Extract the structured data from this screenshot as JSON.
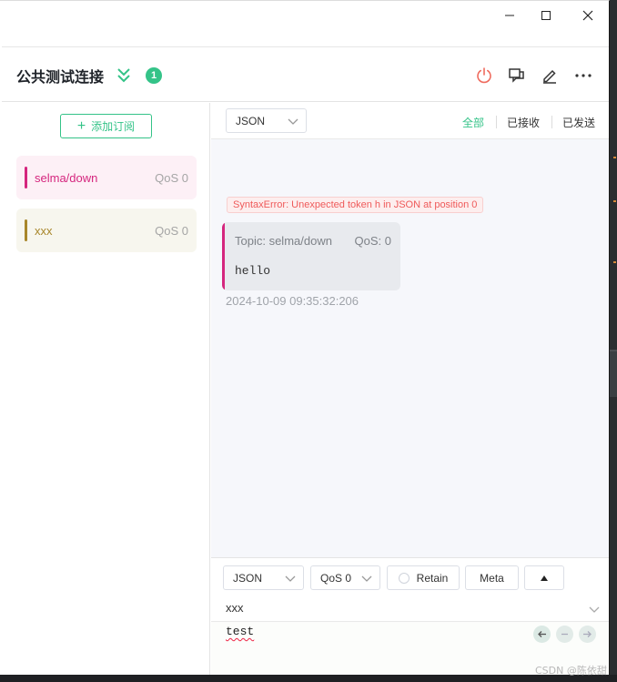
{
  "window": {
    "controls": [
      "minimize",
      "maximize",
      "close"
    ]
  },
  "header": {
    "title": "公共测试连接",
    "badge_count": "1",
    "icons": [
      "disconnect-icon",
      "new-window-icon",
      "edit-icon",
      "more-icon"
    ]
  },
  "sidebar": {
    "add_subscription_label": "添加订阅",
    "subscriptions": [
      {
        "topic": "selma/down",
        "qos": "QoS 0",
        "color": "#d5267e",
        "bg": "#fdf0f6"
      },
      {
        "topic": "xxx",
        "qos": "QoS 0",
        "color": "#a8862a",
        "bg": "#f7f6ee"
      }
    ]
  },
  "messages_toolbar": {
    "format": "JSON",
    "filters": [
      "全部",
      "已接收",
      "已发送"
    ],
    "active_filter": "全部"
  },
  "error_banner": "SyntaxError: Unexpected token h in JSON at position 0",
  "messages": [
    {
      "topic_label": "Topic: selma/down",
      "qos": "QoS: 0",
      "payload": "hello",
      "time": "2024-10-09 09:35:32:206"
    }
  ],
  "publish": {
    "format": "JSON",
    "qos": "QoS 0",
    "retain_label": "Retain",
    "meta_label": "Meta",
    "topic": "xxx",
    "payload": "test"
  },
  "accent_color": "#34c388",
  "watermark": "CSDN @陈依甜"
}
